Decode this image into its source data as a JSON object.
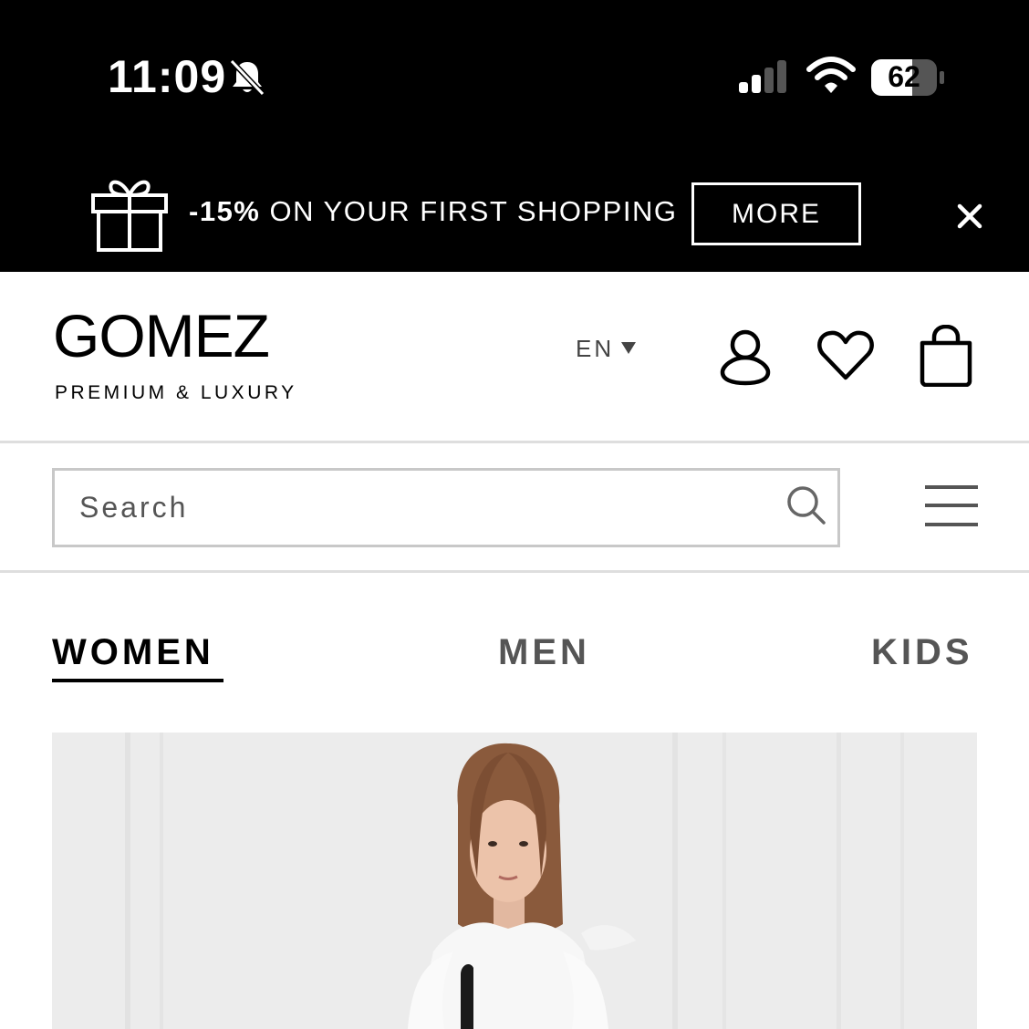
{
  "status_bar": {
    "time": "11:09",
    "battery_percent": "62",
    "signal_bars_active": 2,
    "signal_bars_total": 4
  },
  "promo": {
    "discount": "-15%",
    "text": " ON YOUR FIRST SHOPPING",
    "more_label": "MORE",
    "icon": "gift-icon"
  },
  "header": {
    "logo": "GOMEZ",
    "tagline": "PREMIUM & LUXURY",
    "language": "EN",
    "icons": [
      "user-icon",
      "heart-icon",
      "shopping-bag-icon"
    ]
  },
  "search": {
    "placeholder": "Search"
  },
  "tabs": [
    {
      "label": "WOMEN",
      "active": true
    },
    {
      "label": "MEN",
      "active": false
    },
    {
      "label": "KIDS",
      "active": false
    }
  ],
  "colors": {
    "banner_bg": "#000000",
    "text_primary": "#000000",
    "tab_inactive": "#555555",
    "divider": "#dedede",
    "hero_bg": "#ececec"
  }
}
